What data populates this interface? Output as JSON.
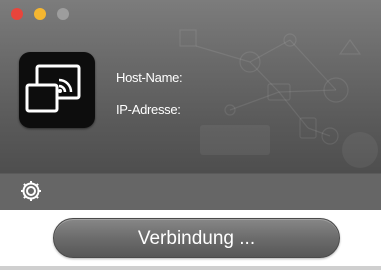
{
  "window": {
    "controls": [
      "close",
      "minimize",
      "zoom"
    ],
    "colors": {
      "close": "#e8453c",
      "minimize": "#f5b630",
      "zoom": "#9d9d9d"
    }
  },
  "app": {
    "icon": "screen-cast-icon"
  },
  "info": {
    "host_label": "Host-Name:",
    "ip_label": "IP-Adresse:"
  },
  "toolbar": {
    "settings_icon": "gear-icon"
  },
  "actions": {
    "connect_label": "Verbindung ..."
  }
}
